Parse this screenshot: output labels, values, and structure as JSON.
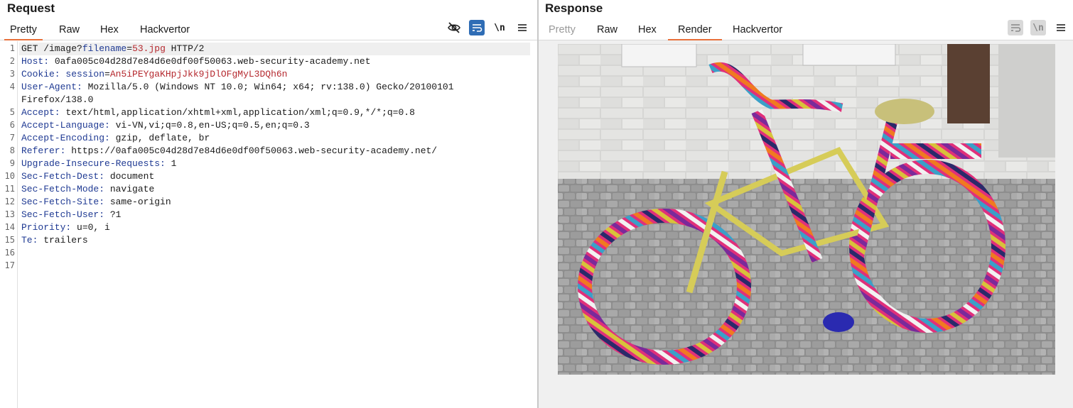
{
  "request": {
    "title": "Request",
    "tabs": [
      "Pretty",
      "Raw",
      "Hex",
      "Hackvertor"
    ],
    "active_tab": "Pretty",
    "toolbar": {
      "hide_icon": "eye-slash-icon",
      "wrap_icon": "wrap-lines-icon",
      "newline_label": "\\n",
      "menu_icon": "hamburger-menu-icon"
    },
    "line_numbers": [
      "1",
      "2",
      "3",
      "4",
      "",
      "5",
      "6",
      "7",
      "8",
      "9",
      "10",
      "11",
      "12",
      "13",
      "14",
      "15",
      "16",
      "17"
    ],
    "lines": {
      "l1": {
        "method": "GET /image?",
        "param": "filename",
        "eq": "=",
        "value": "53.jpg",
        "tail": " HTTP/2"
      },
      "l2": {
        "name": "Host:",
        "value": " 0afa005c04d28d7e84d6e0df00f50063.web-security-academy.net"
      },
      "l3": {
        "name": "Cookie:",
        "sp": " ",
        "param": "session",
        "eq": "=",
        "value": "An5iPEYgaKHpjJkk9jDlOFgMyL3DQh6n"
      },
      "l4": {
        "name": "User-Agent:",
        "value": " Mozilla/5.0 (Windows NT 10.0; Win64; x64; rv:138.0) Gecko/20100101"
      },
      "l4b": {
        "value": "Firefox/138.0"
      },
      "l5": {
        "name": "Accept:",
        "value": " text/html,application/xhtml+xml,application/xml;q=0.9,*/*;q=0.8"
      },
      "l6": {
        "name": "Accept-Language:",
        "value": " vi-VN,vi;q=0.8,en-US;q=0.5,en;q=0.3"
      },
      "l7": {
        "name": "Accept-Encoding:",
        "value": " gzip, deflate, br"
      },
      "l8": {
        "name": "Referer:",
        "value": " https://0afa005c04d28d7e84d6e0df00f50063.web-security-academy.net/"
      },
      "l9": {
        "name": "Upgrade-Insecure-Requests:",
        "value": " 1"
      },
      "l10": {
        "name": "Sec-Fetch-Dest:",
        "value": " document"
      },
      "l11": {
        "name": "Sec-Fetch-Mode:",
        "value": " navigate"
      },
      "l12": {
        "name": "Sec-Fetch-Site:",
        "value": " same-origin"
      },
      "l13": {
        "name": "Sec-Fetch-User:",
        "value": " ?1"
      },
      "l14": {
        "name": "Priority:",
        "value": " u=0, i"
      },
      "l15": {
        "name": "Te:",
        "value": " trailers"
      }
    }
  },
  "response": {
    "title": "Response",
    "tabs": [
      "Pretty",
      "Raw",
      "Hex",
      "Render",
      "Hackvertor"
    ],
    "active_tab": "Render",
    "toolbar": {
      "wrap_icon": "wrap-lines-icon",
      "newline_label": "\\n",
      "menu_icon": "hamburger-menu-icon"
    },
    "render": {
      "image_subject": "knitted-bicycle-photo"
    }
  },
  "colors": {
    "accent": "#e8703a",
    "header_name": "#1f3a93",
    "param_value": "#b5292f",
    "tool_active": "#2f6db5"
  }
}
